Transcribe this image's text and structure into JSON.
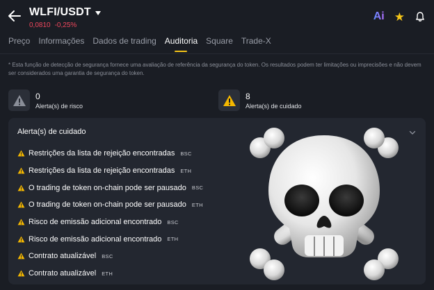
{
  "header": {
    "pair": "WLFI/USDT",
    "price": "0,0810",
    "change": "-0,25%",
    "ai_label": "Ai"
  },
  "tabs": [
    {
      "label": "Preço"
    },
    {
      "label": "Informações"
    },
    {
      "label": "Dados de trading"
    },
    {
      "label": "Auditoria"
    },
    {
      "label": "Square"
    },
    {
      "label": "Trade-X"
    }
  ],
  "disclaimer": "* Esta função de detecção de segurança fornece uma avaliação de referência da segurança do token. Os resultados podem ter limitações ou imprecisões e não devem ser considerados uma garantia de segurança do token.",
  "summary": {
    "risk": {
      "count": "0",
      "label": "Alerta(s) de risco"
    },
    "caution": {
      "count": "8",
      "label": "Alerta(s) de cuidado"
    }
  },
  "panel": {
    "title": "Alerta(s) de cuidado",
    "items": [
      {
        "text": "Restrições da lista de rejeição encontradas",
        "chain": "BSC"
      },
      {
        "text": "Restrições da lista de rejeição encontradas",
        "chain": "ETH"
      },
      {
        "text": "O trading de token on-chain pode ser pausado",
        "chain": "BSC"
      },
      {
        "text": "O trading de token on-chain pode ser pausado",
        "chain": "ETH"
      },
      {
        "text": "Risco de emissão adicional encontrado",
        "chain": "BSC"
      },
      {
        "text": "Risco de emissão adicional encontrado",
        "chain": "ETH"
      },
      {
        "text": "Contrato atualizável",
        "chain": "BSC"
      },
      {
        "text": "Contrato atualizável",
        "chain": "ETH"
      }
    ]
  },
  "colors": {
    "background": "#1a1d24",
    "accent": "#f5c518",
    "negative": "#f0475d",
    "warning": "#f5b800"
  },
  "icons": [
    "back-arrow-icon",
    "caret-down-icon",
    "ai-icon",
    "star-icon",
    "bell-icon",
    "warning-icon",
    "chevron-down-icon",
    "skull-crossbones-emoji"
  ]
}
